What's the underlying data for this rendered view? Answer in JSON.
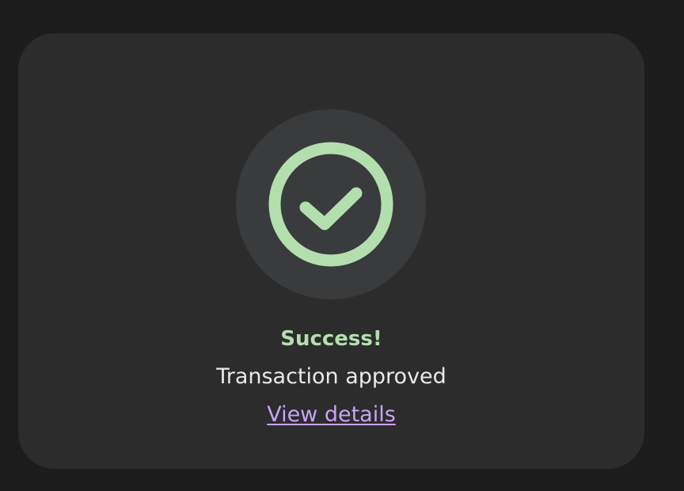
{
  "colors": {
    "background": "#1c1c1c",
    "card": "#2c2c2c",
    "icon_backdrop": "#3a3b3d",
    "success": "#b3dfae",
    "text": "#e9e9ea",
    "link": "#c8a4f5"
  },
  "status": {
    "icon": "check-circle-icon",
    "title": "Success!",
    "message": "Transaction approved",
    "link_label": "View details"
  }
}
